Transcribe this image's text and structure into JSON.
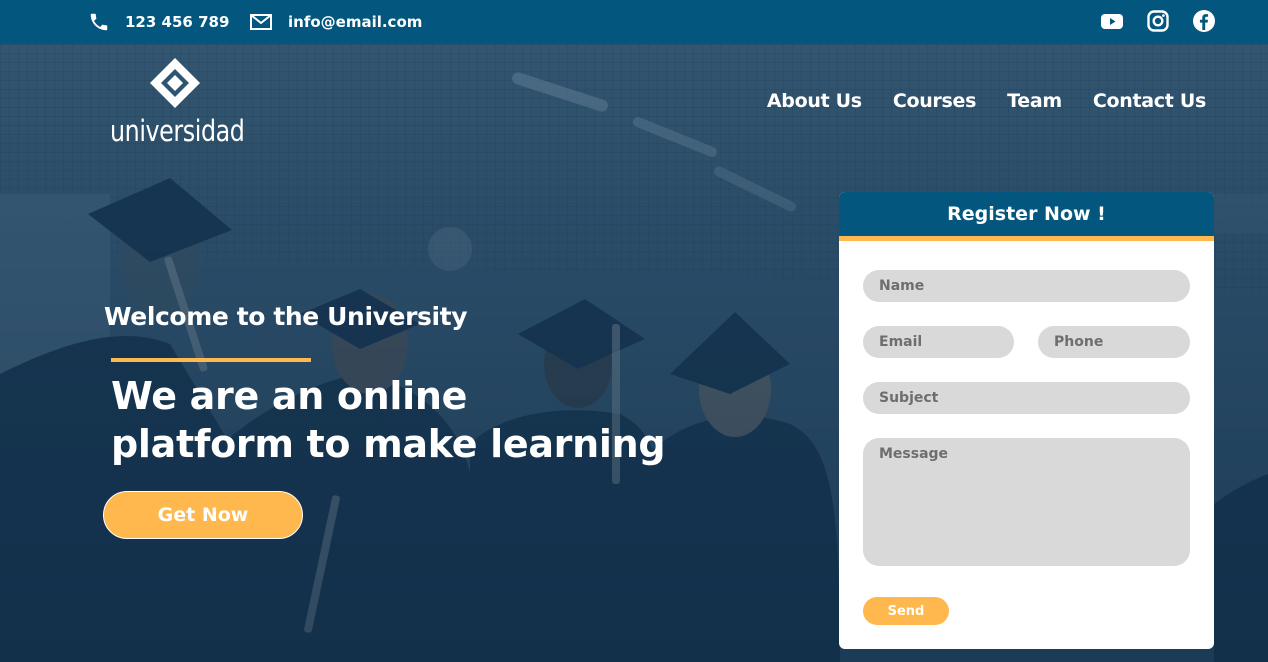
{
  "topbar": {
    "phone": "123 456 789",
    "email": "info@email.com",
    "socials": [
      "youtube-icon",
      "instagram-icon",
      "facebook-icon"
    ]
  },
  "logo": {
    "brand": "universidad"
  },
  "nav": {
    "items": [
      "About Us",
      "Courses",
      "Team",
      "Contact Us"
    ]
  },
  "hero": {
    "welcome": "Welcome to the University",
    "headline_line1": "We are an online",
    "headline_line2": "platform to make learning",
    "cta_label": "Get Now"
  },
  "register": {
    "title": "Register Now !",
    "name_placeholder": "Name",
    "email_placeholder": "Email",
    "phone_placeholder": "Phone",
    "subject_placeholder": "Subject",
    "message_placeholder": "Message",
    "send_label": "Send"
  },
  "colors": {
    "primary": "#03577f",
    "accent": "#ffb84d",
    "field": "#d9d9d9",
    "overlay": "#163f60"
  }
}
